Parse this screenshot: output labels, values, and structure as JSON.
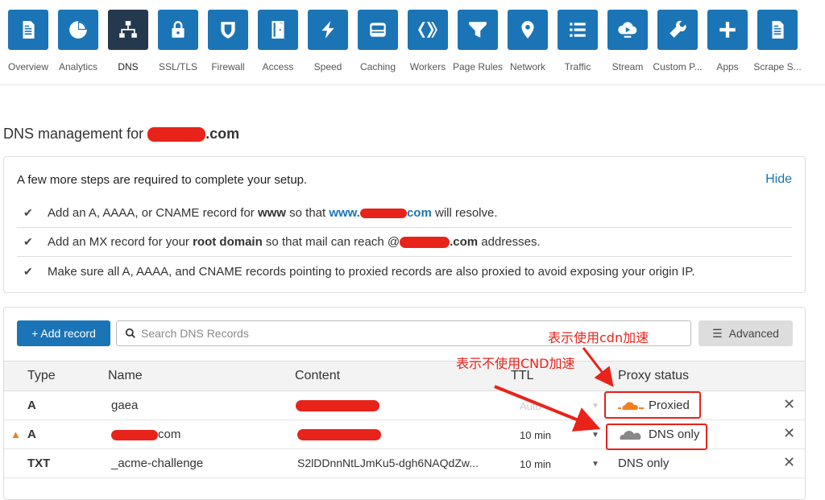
{
  "nav": [
    {
      "label": "Overview",
      "icon": "document-icon"
    },
    {
      "label": "Analytics",
      "icon": "pie-chart-icon"
    },
    {
      "label": "DNS",
      "icon": "network-icon",
      "active": true
    },
    {
      "label": "SSL/TLS",
      "icon": "lock-icon"
    },
    {
      "label": "Firewall",
      "icon": "shield-icon"
    },
    {
      "label": "Access",
      "icon": "door-icon"
    },
    {
      "label": "Speed",
      "icon": "lightning-icon"
    },
    {
      "label": "Caching",
      "icon": "hard-drive-icon"
    },
    {
      "label": "Workers",
      "icon": "workers-icon"
    },
    {
      "label": "Page Rules",
      "icon": "filter-icon"
    },
    {
      "label": "Network",
      "icon": "location-pin-icon"
    },
    {
      "label": "Traffic",
      "icon": "list-icon"
    },
    {
      "label": "Stream",
      "icon": "cloud-play-icon"
    },
    {
      "label": "Custom P...",
      "icon": "wrench-icon"
    },
    {
      "label": "Apps",
      "icon": "plus-icon"
    },
    {
      "label": "Scrape S...",
      "icon": "document-icon"
    }
  ],
  "title": {
    "prefix": "DNS management for ",
    "suffix": ".com"
  },
  "setup": {
    "heading": "A few more steps are required to complete your setup.",
    "hide": "Hide",
    "step1": {
      "a": "Add an A, AAAA, or CNAME record for ",
      "b": "www",
      "c": " so that ",
      "link_pre": "www.",
      "link_post": "com",
      "d": " will resolve."
    },
    "step2": {
      "a": "Add an MX record for your ",
      "b": "root domain",
      "c": " so that mail can reach @",
      "d": ".com",
      "e": " addresses."
    },
    "step3": "Make sure all A, AAAA, and CNAME records pointing to proxied records are also proxied to avoid exposing your origin IP."
  },
  "toolbar": {
    "add": "+ Add record",
    "search_placeholder": "Search DNS Records",
    "advanced": "Advanced"
  },
  "columns": [
    "Type",
    "Name",
    "Content",
    "TTL",
    "Proxy status"
  ],
  "rows": [
    {
      "type": "A",
      "name": "gaea",
      "content": "",
      "ttl": "Auto",
      "proxy": "Proxied",
      "proxied": true,
      "warning": false
    },
    {
      "type": "A",
      "name": "com",
      "content": "",
      "ttl": "10 min",
      "proxy": "DNS only",
      "proxied": false,
      "warning": true
    },
    {
      "type": "TXT",
      "name": "_acme-challenge",
      "content": "S2lDDnnNtLJmKu5-dgh6NAQdZw...",
      "ttl": "10 min",
      "proxy": "DNS only",
      "proxied": false,
      "warning": false
    }
  ],
  "annotations": {
    "cdn": "表示使用cdn加速",
    "no_cdn": "表示不使用CND加速"
  },
  "colors": {
    "accent": "#1b74b5",
    "active_nav": "#24384e",
    "annotation": "#e8231a",
    "proxied_cloud": "#f38020"
  }
}
